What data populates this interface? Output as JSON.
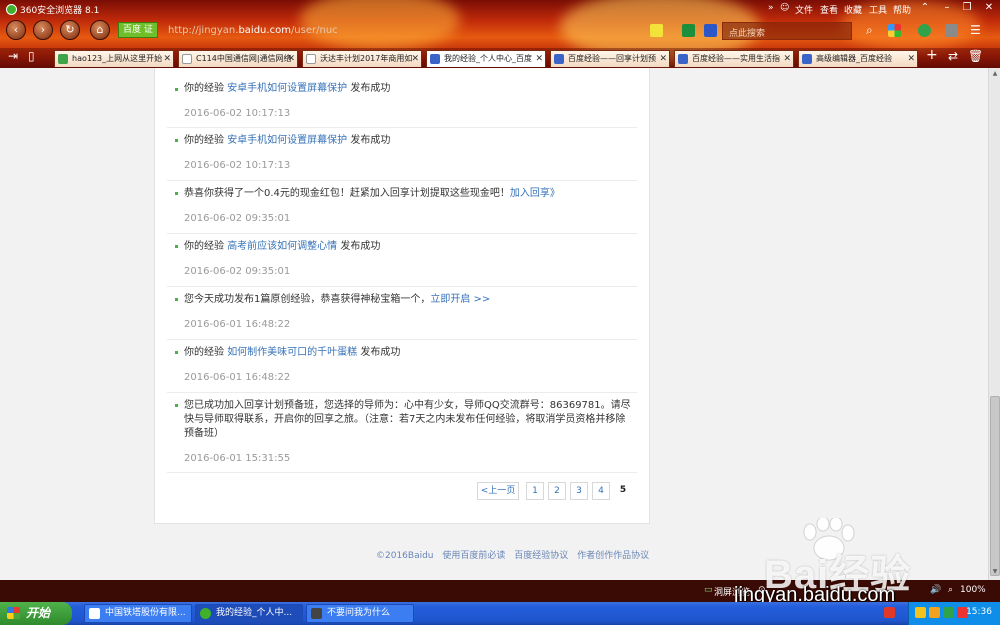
{
  "browser": {
    "title": "360安全浏览器 8.1",
    "menus": [
      "文件",
      "查看",
      "收藏",
      "工具",
      "帮助"
    ],
    "security_badge": "百度 证",
    "url_prefix": "http://jingyan.",
    "url_domain": "baidu.com",
    "url_path": "/user/nuc",
    "search_placeholder": "点此搜索",
    "tabs": [
      {
        "label": "hao123_上网从这里开始",
        "icon": "hao123-icon"
      },
      {
        "label": "C114中国通信网|通信网络",
        "icon": "page-icon"
      },
      {
        "label": "沃达丰计划2017年商用如",
        "icon": "page-icon"
      },
      {
        "label": "我的经验_个人中心_百度",
        "icon": "baidu-paw-icon"
      },
      {
        "label": "百度经验——回享计划预",
        "icon": "baidu-paw-icon"
      },
      {
        "label": "百度经验——实用生活指",
        "icon": "baidu-paw-icon"
      },
      {
        "label": "高级编辑器_百度经验",
        "icon": "baidu-paw-icon"
      }
    ]
  },
  "messages": [
    {
      "prefix": "你的经验 ",
      "link": "安卓手机如何设置屏幕保护",
      "suffix": " 发布成功",
      "time": "2016-06-02 10:17:13"
    },
    {
      "prefix": "你的经验 ",
      "link": "安卓手机如何设置屏幕保护",
      "suffix": " 发布成功",
      "time": "2016-06-02 10:17:13"
    },
    {
      "prefix": "恭喜你获得了一个0.4元的现金红包！赶紧加入回享计划提取这些现金吧！",
      "link": "加入回享》",
      "suffix": "",
      "time": "2016-06-02 09:35:01"
    },
    {
      "prefix": "你的经验 ",
      "link": "高考前应该如何调整心情",
      "suffix": " 发布成功",
      "time": "2016-06-02 09:35:01"
    },
    {
      "prefix": "您今天成功发布1篇原创经验，恭喜获得神秘宝箱一个，",
      "link": "立即开启 >>",
      "suffix": "",
      "time": "2016-06-01 16:48:22"
    },
    {
      "prefix": "你的经验 ",
      "link": "如何制作美味可口的千叶蛋糕",
      "suffix": " 发布成功",
      "time": "2016-06-01 16:48:22"
    },
    {
      "prefix": "您已成功加入回享计划预备班，您选择的导师为：心中有少女，导师QQ交流群号：86369781。请尽快与导师取得联系，开启你的回享之旅。（注意：若7天之内未发布任何经验，将取消学员资格并移除预备班）",
      "link": "",
      "suffix": "",
      "time": "2016-06-01 15:31:55"
    }
  ],
  "pagination": {
    "prev": "<上一页",
    "pages": [
      "1",
      "2",
      "3",
      "4",
      "5"
    ],
    "current": "5"
  },
  "footer": {
    "copyright": "©2016Baidu",
    "links": [
      "使用百度前必读",
      "百度经验协议",
      "作者创作作品协议"
    ]
  },
  "statusbar": {
    "fullscreen": "洞屏浏览",
    "zoom": "100%"
  },
  "watermark": {
    "brand": "Bai经验",
    "url": "jingyan.baidu.com"
  },
  "taskbar": {
    "start": "开始",
    "tasks": [
      "中国铁塔股份有限...",
      "我的经验_个人中...",
      "不要问我为什么"
    ],
    "clock": "15:36"
  },
  "colors": {
    "link": "#3672b8",
    "chrome_red": "#c02a0a",
    "taskbar_blue": "#245edb"
  }
}
